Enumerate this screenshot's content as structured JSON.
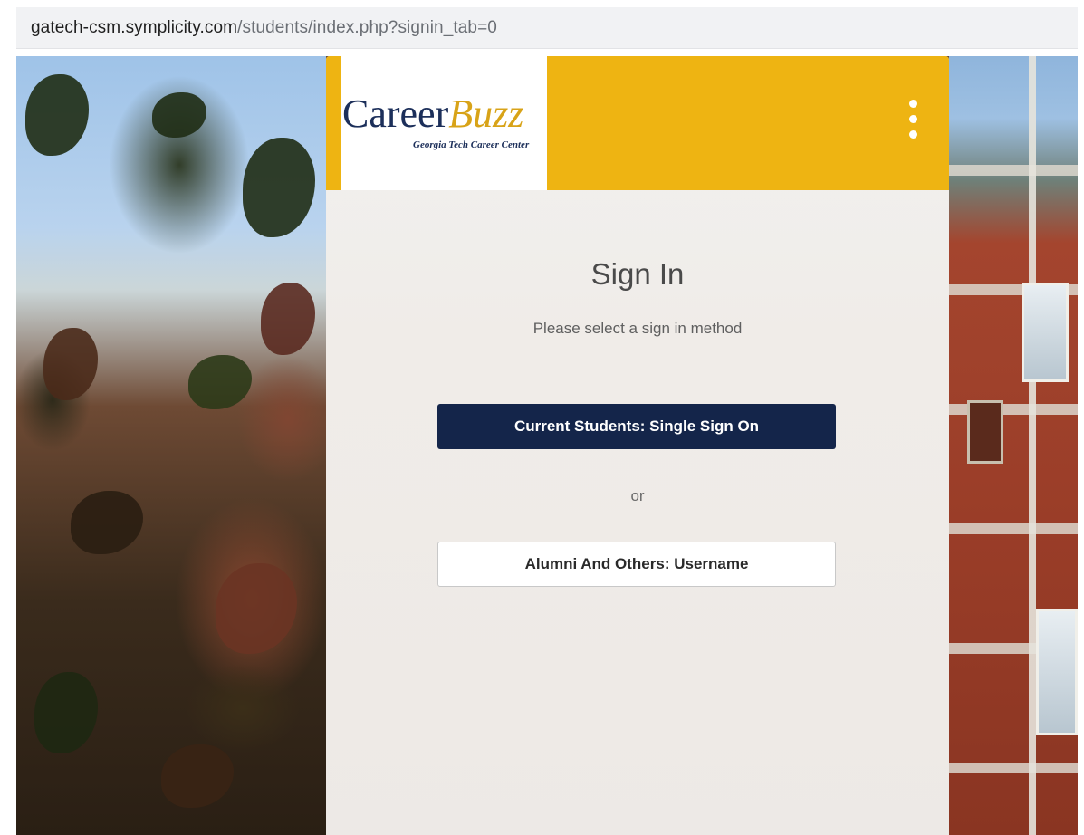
{
  "browser": {
    "url_host": "gatech-csm.symplicity.com",
    "url_path": "/students/index.php?signin_tab=0"
  },
  "header": {
    "logo_primary": "Career",
    "logo_accent": "Buzz",
    "logo_subtitle": "Georgia Tech Career Center",
    "menu_icon": "kebab-menu-icon",
    "header_color": "#eeb412"
  },
  "signin": {
    "title": "Sign In",
    "subtitle": "Please select a sign in method",
    "sso_button_label": "Current Students: Single Sign On",
    "separator": "or",
    "alumni_button_label": "Alumni And Others: Username",
    "primary_button_color": "#14254a"
  }
}
